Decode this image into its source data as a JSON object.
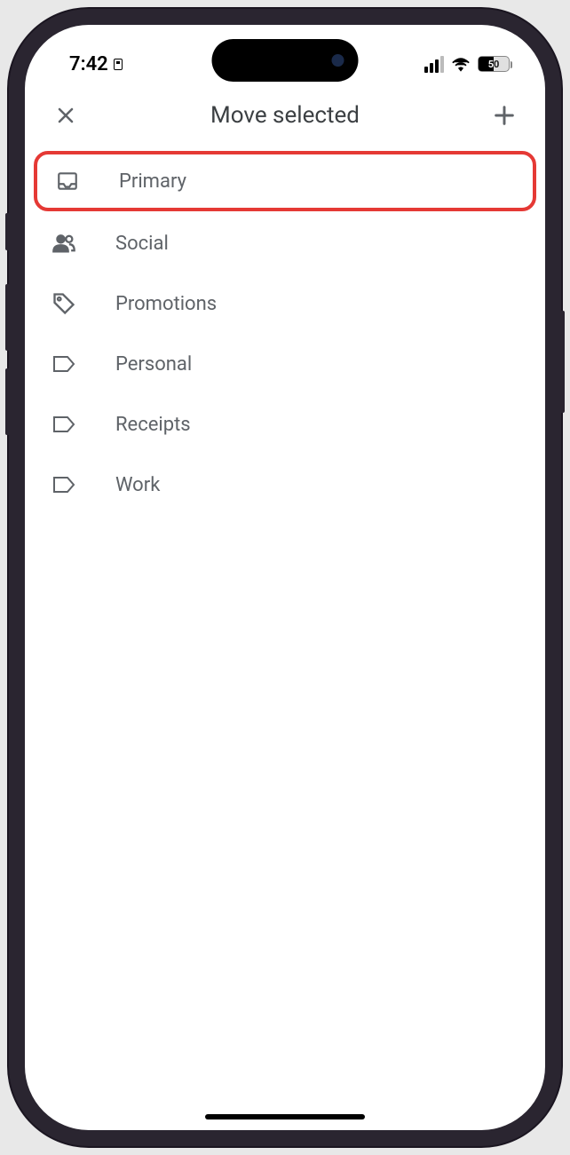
{
  "status": {
    "time": "7:42",
    "battery": "50"
  },
  "header": {
    "title": "Move selected"
  },
  "items": [
    {
      "label": "Primary"
    },
    {
      "label": "Social"
    },
    {
      "label": "Promotions"
    },
    {
      "label": "Personal"
    },
    {
      "label": "Receipts"
    },
    {
      "label": "Work"
    }
  ]
}
